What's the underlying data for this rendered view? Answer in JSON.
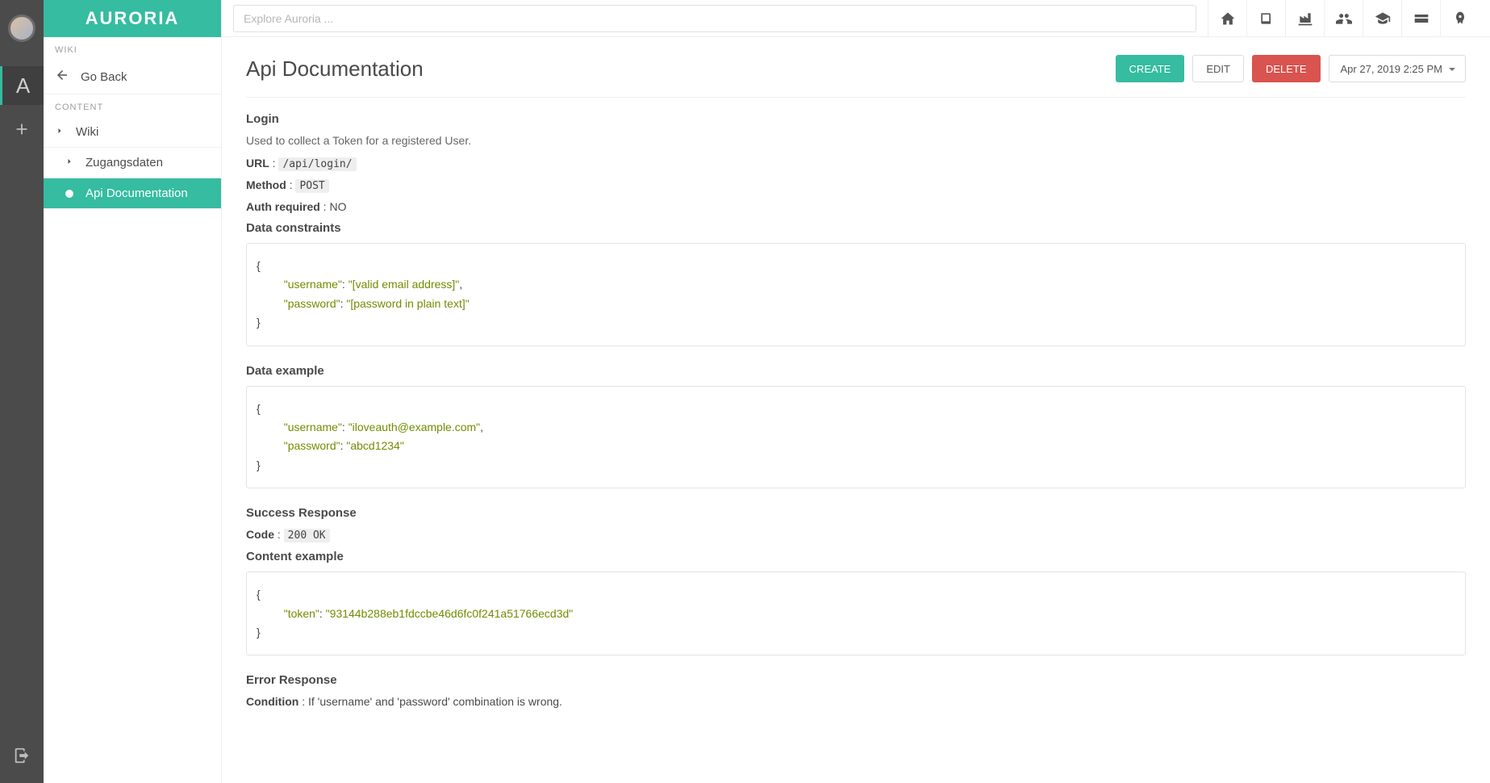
{
  "brand": "AURORIA",
  "search": {
    "placeholder": "Explore Auroria ..."
  },
  "topicons": [
    {
      "name": "home-icon"
    },
    {
      "name": "book-icon"
    },
    {
      "name": "industry-icon"
    },
    {
      "name": "users-icon"
    },
    {
      "name": "graduation-icon"
    },
    {
      "name": "card-icon"
    },
    {
      "name": "rocket-icon"
    }
  ],
  "sidebar": {
    "section1_title": "WIKI",
    "goback_label": "Go Back",
    "section2_title": "CONTENT",
    "items": {
      "root": "Wiki",
      "child1": "Zugangsdaten",
      "child2": "Api Documentation"
    }
  },
  "page": {
    "title": "Api Documentation",
    "create": "CREATE",
    "edit": "EDIT",
    "delete": "DELETE",
    "date": "Apr 27, 2019 2:25 PM"
  },
  "doc": {
    "login_heading": "Login",
    "login_desc": "Used to collect a Token for a registered User.",
    "url_label": "URL",
    "url_value": "/api/login/",
    "method_label": "Method",
    "method_value": "POST",
    "auth_label": "Auth required",
    "auth_value": "NO",
    "constraints_label": "Data constraints",
    "constraints_code": {
      "k1": "\"username\"",
      "v1": "\"[valid email address]\"",
      "k2": "\"password\"",
      "v2": "\"[password in plain text]\""
    },
    "example_label": "Data example",
    "example_code": {
      "k1": "\"username\"",
      "v1": "\"iloveauth@example.com\"",
      "k2": "\"password\"",
      "v2": "\"abcd1234\""
    },
    "success_label": "Success Response",
    "code_label": "Code",
    "code_value": "200 OK",
    "content_example_label": "Content example",
    "token_code": {
      "k1": "\"token\"",
      "v1": "\"93144b288eb1fdccbe46d6fc0f241a51766ecd3d\""
    },
    "error_label": "Error Response",
    "condition_label": "Condition",
    "condition_value": "If 'username' and 'password' combination is wrong."
  },
  "glyph": {
    "colon": " : ",
    "colonsp": ": ",
    "comma": ",",
    "lbrace": "{",
    "rbrace": "}"
  }
}
